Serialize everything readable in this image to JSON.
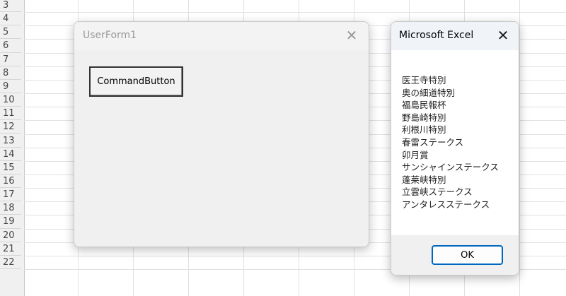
{
  "spreadsheet": {
    "row_numbers": [
      "3",
      "4",
      "5",
      "6",
      "7",
      "8",
      "9",
      "10",
      "11",
      "12",
      "13",
      "14",
      "15",
      "16",
      "17",
      "18",
      "19",
      "20",
      "21",
      "22"
    ]
  },
  "userform": {
    "title": "UserForm1",
    "close_label": "✕",
    "command_button_label": "CommandButton"
  },
  "msgbox": {
    "title": "Microsoft Excel",
    "close_label": "✕",
    "lines": [
      "医王寺特別",
      "奥の細道特別",
      "福島民報杯",
      "野島崎特別",
      "利根川特別",
      "春雷ステークス",
      "卯月賞",
      "サンシャインステークス",
      "蓬莱峡特別",
      "立雲峡ステークス",
      "アンタレスステークス"
    ],
    "ok_label": "OK"
  },
  "colors": {
    "ok_border": "#0067c0",
    "grid": "#e1e1e1"
  }
}
